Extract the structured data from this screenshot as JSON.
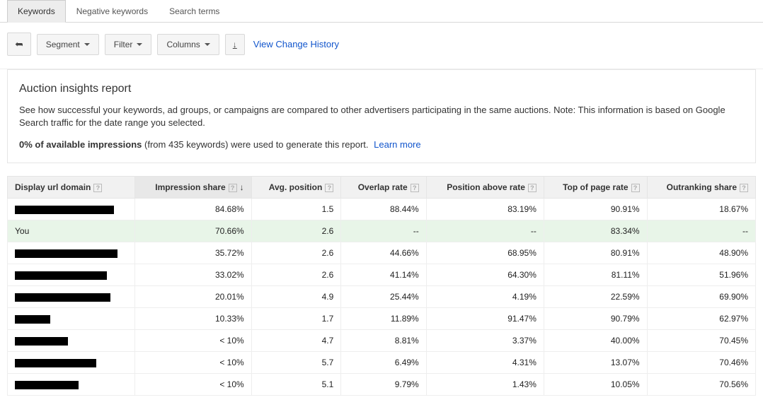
{
  "tabs": {
    "keywords": "Keywords",
    "negative": "Negative keywords",
    "search": "Search terms"
  },
  "toolbar": {
    "segment": "Segment",
    "filter": "Filter",
    "columns": "Columns",
    "history_link": "View Change History"
  },
  "panel": {
    "title": "Auction insights report",
    "desc": "See how successful your keywords, ad groups, or campaigns are compared to other advertisers participating in the same auctions. Note: This information is based on Google Search traffic for the date range you selected.",
    "imp_bold": "0% of available impressions",
    "imp_rest": " (from 435 keywords) were used to generate this report. ",
    "learn_more": "Learn more"
  },
  "columns": {
    "domain": "Display url domain",
    "impshare": "Impression share",
    "avgpos": "Avg. position",
    "overlap": "Overlap rate",
    "posabove": "Position above rate",
    "topofpage": "Top of page rate",
    "outrank": "Outranking share"
  },
  "rows": [
    {
      "domain": "",
      "redact_w": 140,
      "impshare": "84.68%",
      "avgpos": "1.5",
      "overlap": "88.44%",
      "posabove": "83.19%",
      "topofpage": "90.91%",
      "outrank": "18.67%",
      "highlight": false
    },
    {
      "domain": "You",
      "redact_w": 0,
      "impshare": "70.66%",
      "avgpos": "2.6",
      "overlap": "--",
      "posabove": "--",
      "topofpage": "83.34%",
      "outrank": "--",
      "highlight": true
    },
    {
      "domain": "",
      "redact_w": 145,
      "impshare": "35.72%",
      "avgpos": "2.6",
      "overlap": "44.66%",
      "posabove": "68.95%",
      "topofpage": "80.91%",
      "outrank": "48.90%",
      "highlight": false
    },
    {
      "domain": "",
      "redact_w": 130,
      "impshare": "33.02%",
      "avgpos": "2.6",
      "overlap": "41.14%",
      "posabove": "64.30%",
      "topofpage": "81.11%",
      "outrank": "51.96%",
      "highlight": false
    },
    {
      "domain": "",
      "redact_w": 135,
      "impshare": "20.01%",
      "avgpos": "4.9",
      "overlap": "25.44%",
      "posabove": "4.19%",
      "topofpage": "22.59%",
      "outrank": "69.90%",
      "highlight": false
    },
    {
      "domain": "",
      "redact_w": 50,
      "impshare": "10.33%",
      "avgpos": "1.7",
      "overlap": "11.89%",
      "posabove": "91.47%",
      "topofpage": "90.79%",
      "outrank": "62.97%",
      "highlight": false
    },
    {
      "domain": "",
      "redact_w": 75,
      "impshare": "< 10%",
      "avgpos": "4.7",
      "overlap": "8.81%",
      "posabove": "3.37%",
      "topofpage": "40.00%",
      "outrank": "70.45%",
      "highlight": false
    },
    {
      "domain": "",
      "redact_w": 115,
      "impshare": "< 10%",
      "avgpos": "5.7",
      "overlap": "6.49%",
      "posabove": "4.31%",
      "topofpage": "13.07%",
      "outrank": "70.46%",
      "highlight": false
    },
    {
      "domain": "",
      "redact_w": 90,
      "impshare": "< 10%",
      "avgpos": "5.1",
      "overlap": "9.79%",
      "posabove": "1.43%",
      "topofpage": "10.05%",
      "outrank": "70.56%",
      "highlight": false
    }
  ]
}
